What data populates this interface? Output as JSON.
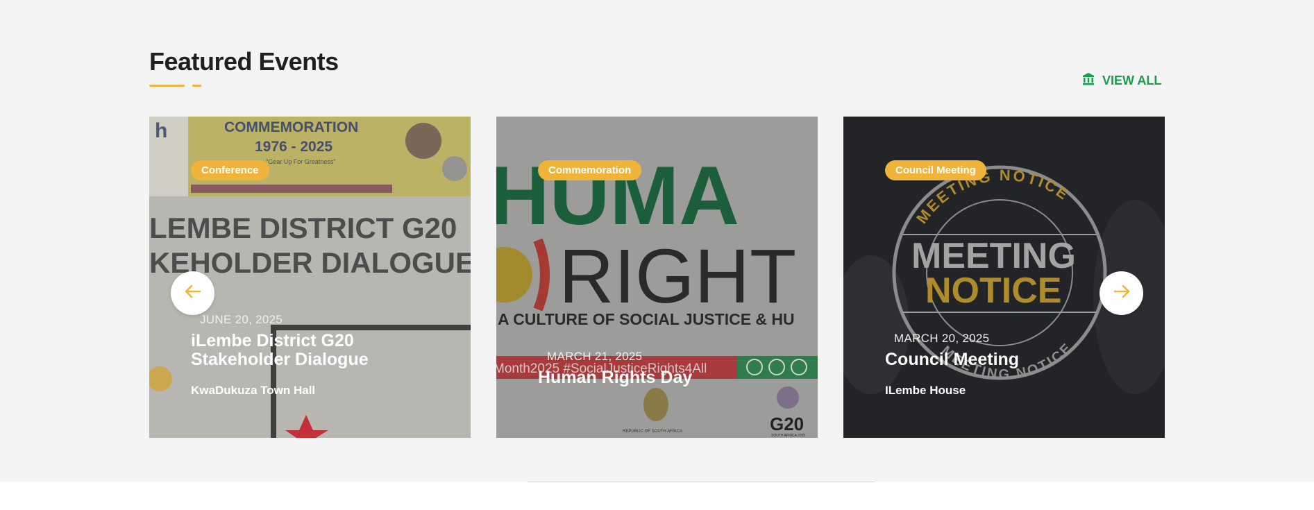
{
  "section": {
    "title": "Featured Events",
    "view_all": "VIEW ALL"
  },
  "colors": {
    "accent": "#f0b43a",
    "green": "#1a9d4f"
  },
  "events": [
    {
      "category": "Conference",
      "date": "JUNE 20, 2025",
      "title": "iLembe District G20 Stakeholder Dialogue",
      "venue": "KwaDukuza Town Hall",
      "poster": {
        "banner_title": "COMMEMORATION",
        "banner_years": "1976 - 2025",
        "banner_tagline": "\"Gear Up For Greatness\"",
        "line1": "LEMBE DISTRICT G20",
        "line2": "KEHOLDER DIALOGUE"
      }
    },
    {
      "category": "Commemoration",
      "date": "MARCH 21, 2025",
      "title": "Human Rights Day",
      "venue": "",
      "poster": {
        "big1": "HUMA",
        "big2": "RIGHT",
        "tagline": "A CULTURE OF SOCIAL JUSTICE & HU",
        "hashtag": "Month2025 #SocialJusticeRights4All",
        "coat_caption": "REPUBLIC OF SOUTH AFRICA",
        "g20": "G20",
        "g20_sub": "SOUTH AFRICA 2025"
      }
    },
    {
      "category": "Council Meeting",
      "date": "MARCH 20, 2025",
      "title": "Council Meeting",
      "venue": "ILembe House",
      "poster": {
        "ring_top": "MEETING NOTICE",
        "center1": "MEETING",
        "center2": "NOTICE",
        "ring_bottom": "MEETING NOTICE"
      }
    }
  ]
}
